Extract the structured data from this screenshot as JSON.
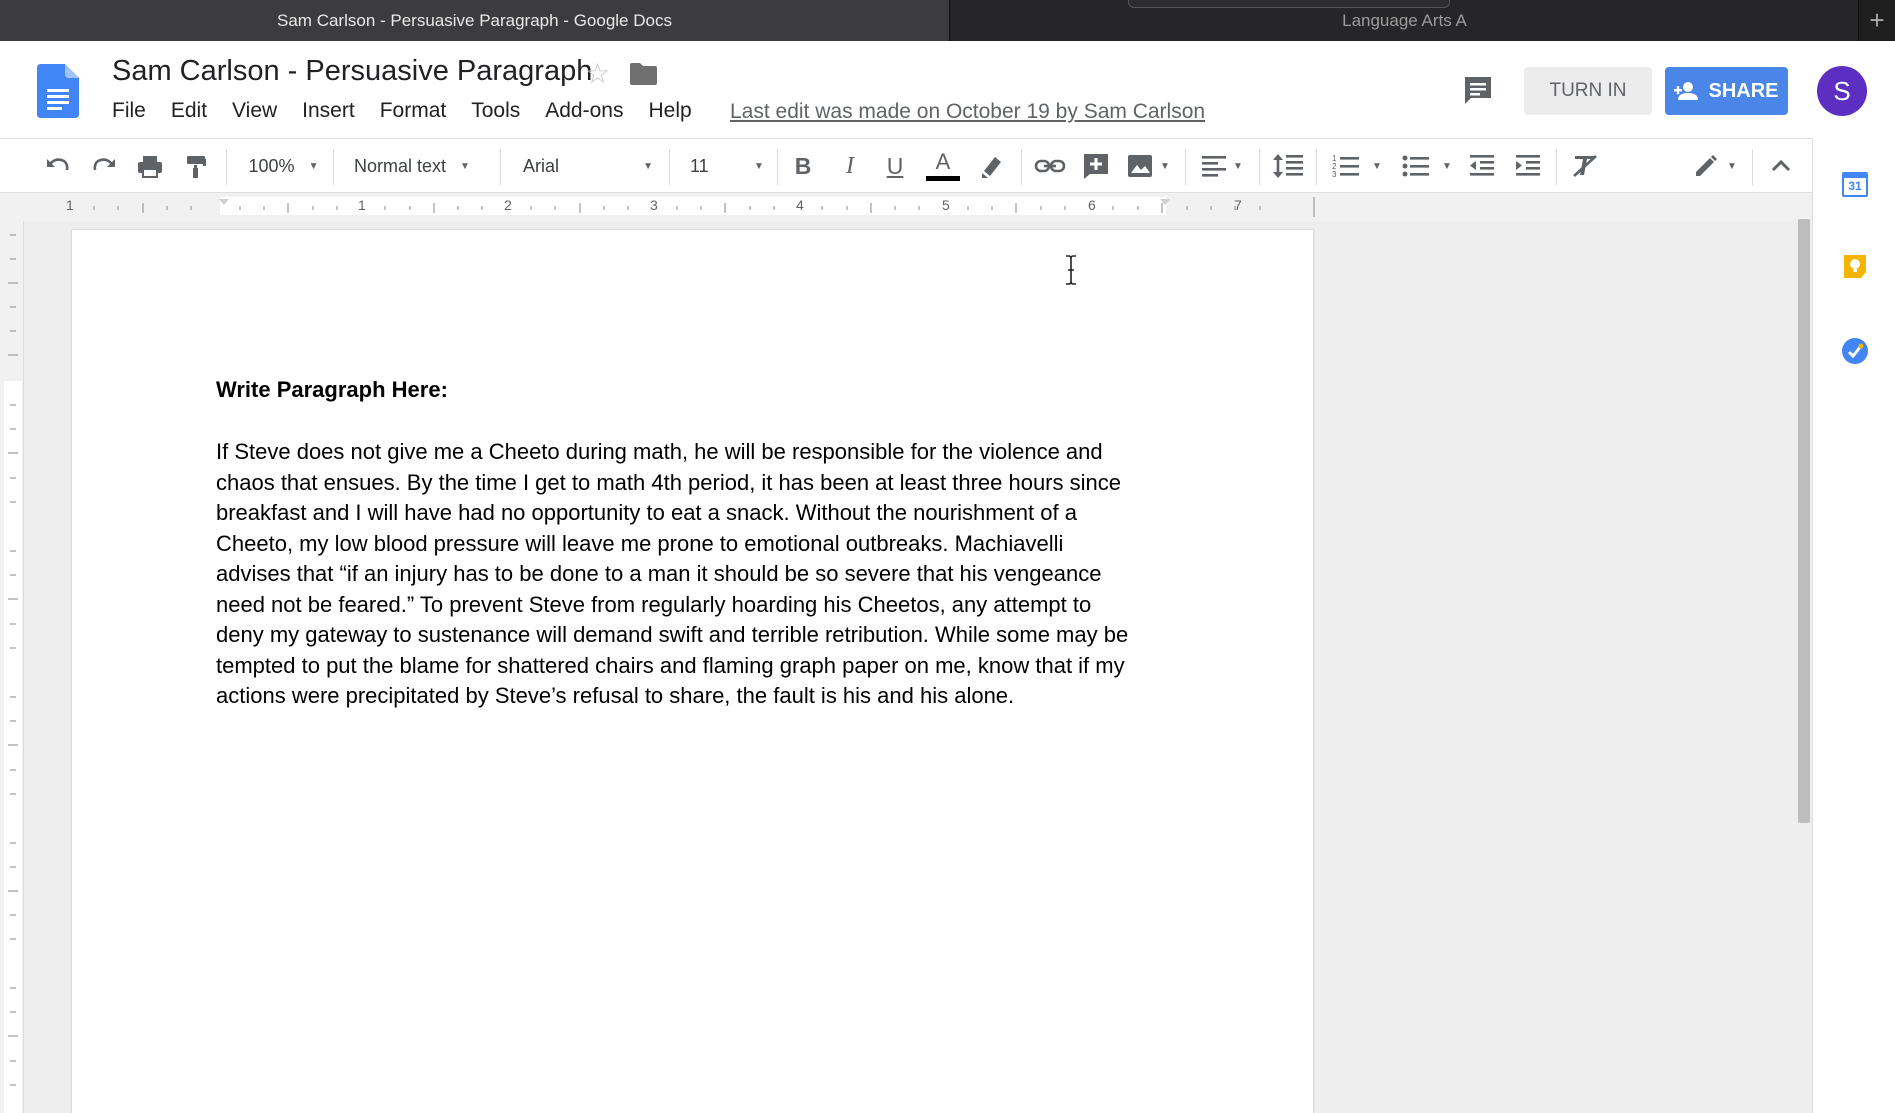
{
  "browser": {
    "tabs": [
      {
        "title": "Sam Carlson - Persuasive Paragraph - Google Docs",
        "active": true
      },
      {
        "title": "Language Arts A",
        "active": false
      }
    ],
    "new_tab_label": "+"
  },
  "doc": {
    "title": "Sam Carlson - Persuasive Paragraph",
    "menu": [
      "File",
      "Edit",
      "View",
      "Insert",
      "Format",
      "Tools",
      "Add-ons",
      "Help"
    ],
    "last_edit": "Last edit was made on October 19 by Sam Carlson"
  },
  "header_actions": {
    "turn_in": "TURN IN",
    "share": "SHARE",
    "avatar_initial": "S",
    "brand_color": "#4a86e8",
    "avatar_color": "#5c2fc2"
  },
  "toolbar": {
    "zoom": "100%",
    "style": "Normal text",
    "font": "Arial",
    "font_size": "11",
    "bold_glyph": "B",
    "italic_glyph": "I",
    "underline_glyph": "U",
    "text_color_glyph": "A"
  },
  "ruler": {
    "numbers": [
      "1",
      "1",
      "2",
      "3",
      "4",
      "5",
      "6",
      "7"
    ]
  },
  "page": {
    "heading": "Write Paragraph Here:",
    "paragraph_lines": [
      "If Steve does not give me a Cheeto during math, he will be responsible for the violence and",
      "chaos that ensues. By the time I get to math 4th period, it has been at least three hours since",
      "breakfast and I will have had no opportunity to eat a snack. Without the nourishment of a",
      "Cheeto, my low blood pressure will leave me prone to emotional outbreaks. Machiavelli",
      "advises that “if an injury has to be done to a man it should be so severe that his vengeance",
      "need not be feared.” To prevent Steve from regularly hoarding his Cheetos, any attempt to",
      "deny my gateway to sustenance will demand swift and terrible retribution. While some may be",
      "tempted to put the blame for shattered chairs and flaming graph paper on me, know that if my",
      "actions were precipitated by Steve’s refusal to share, the fault is his and his alone."
    ]
  },
  "side_panel": {
    "calendar_day": "31",
    "icons": [
      "calendar-icon",
      "keep-icon",
      "tasks-icon"
    ]
  }
}
